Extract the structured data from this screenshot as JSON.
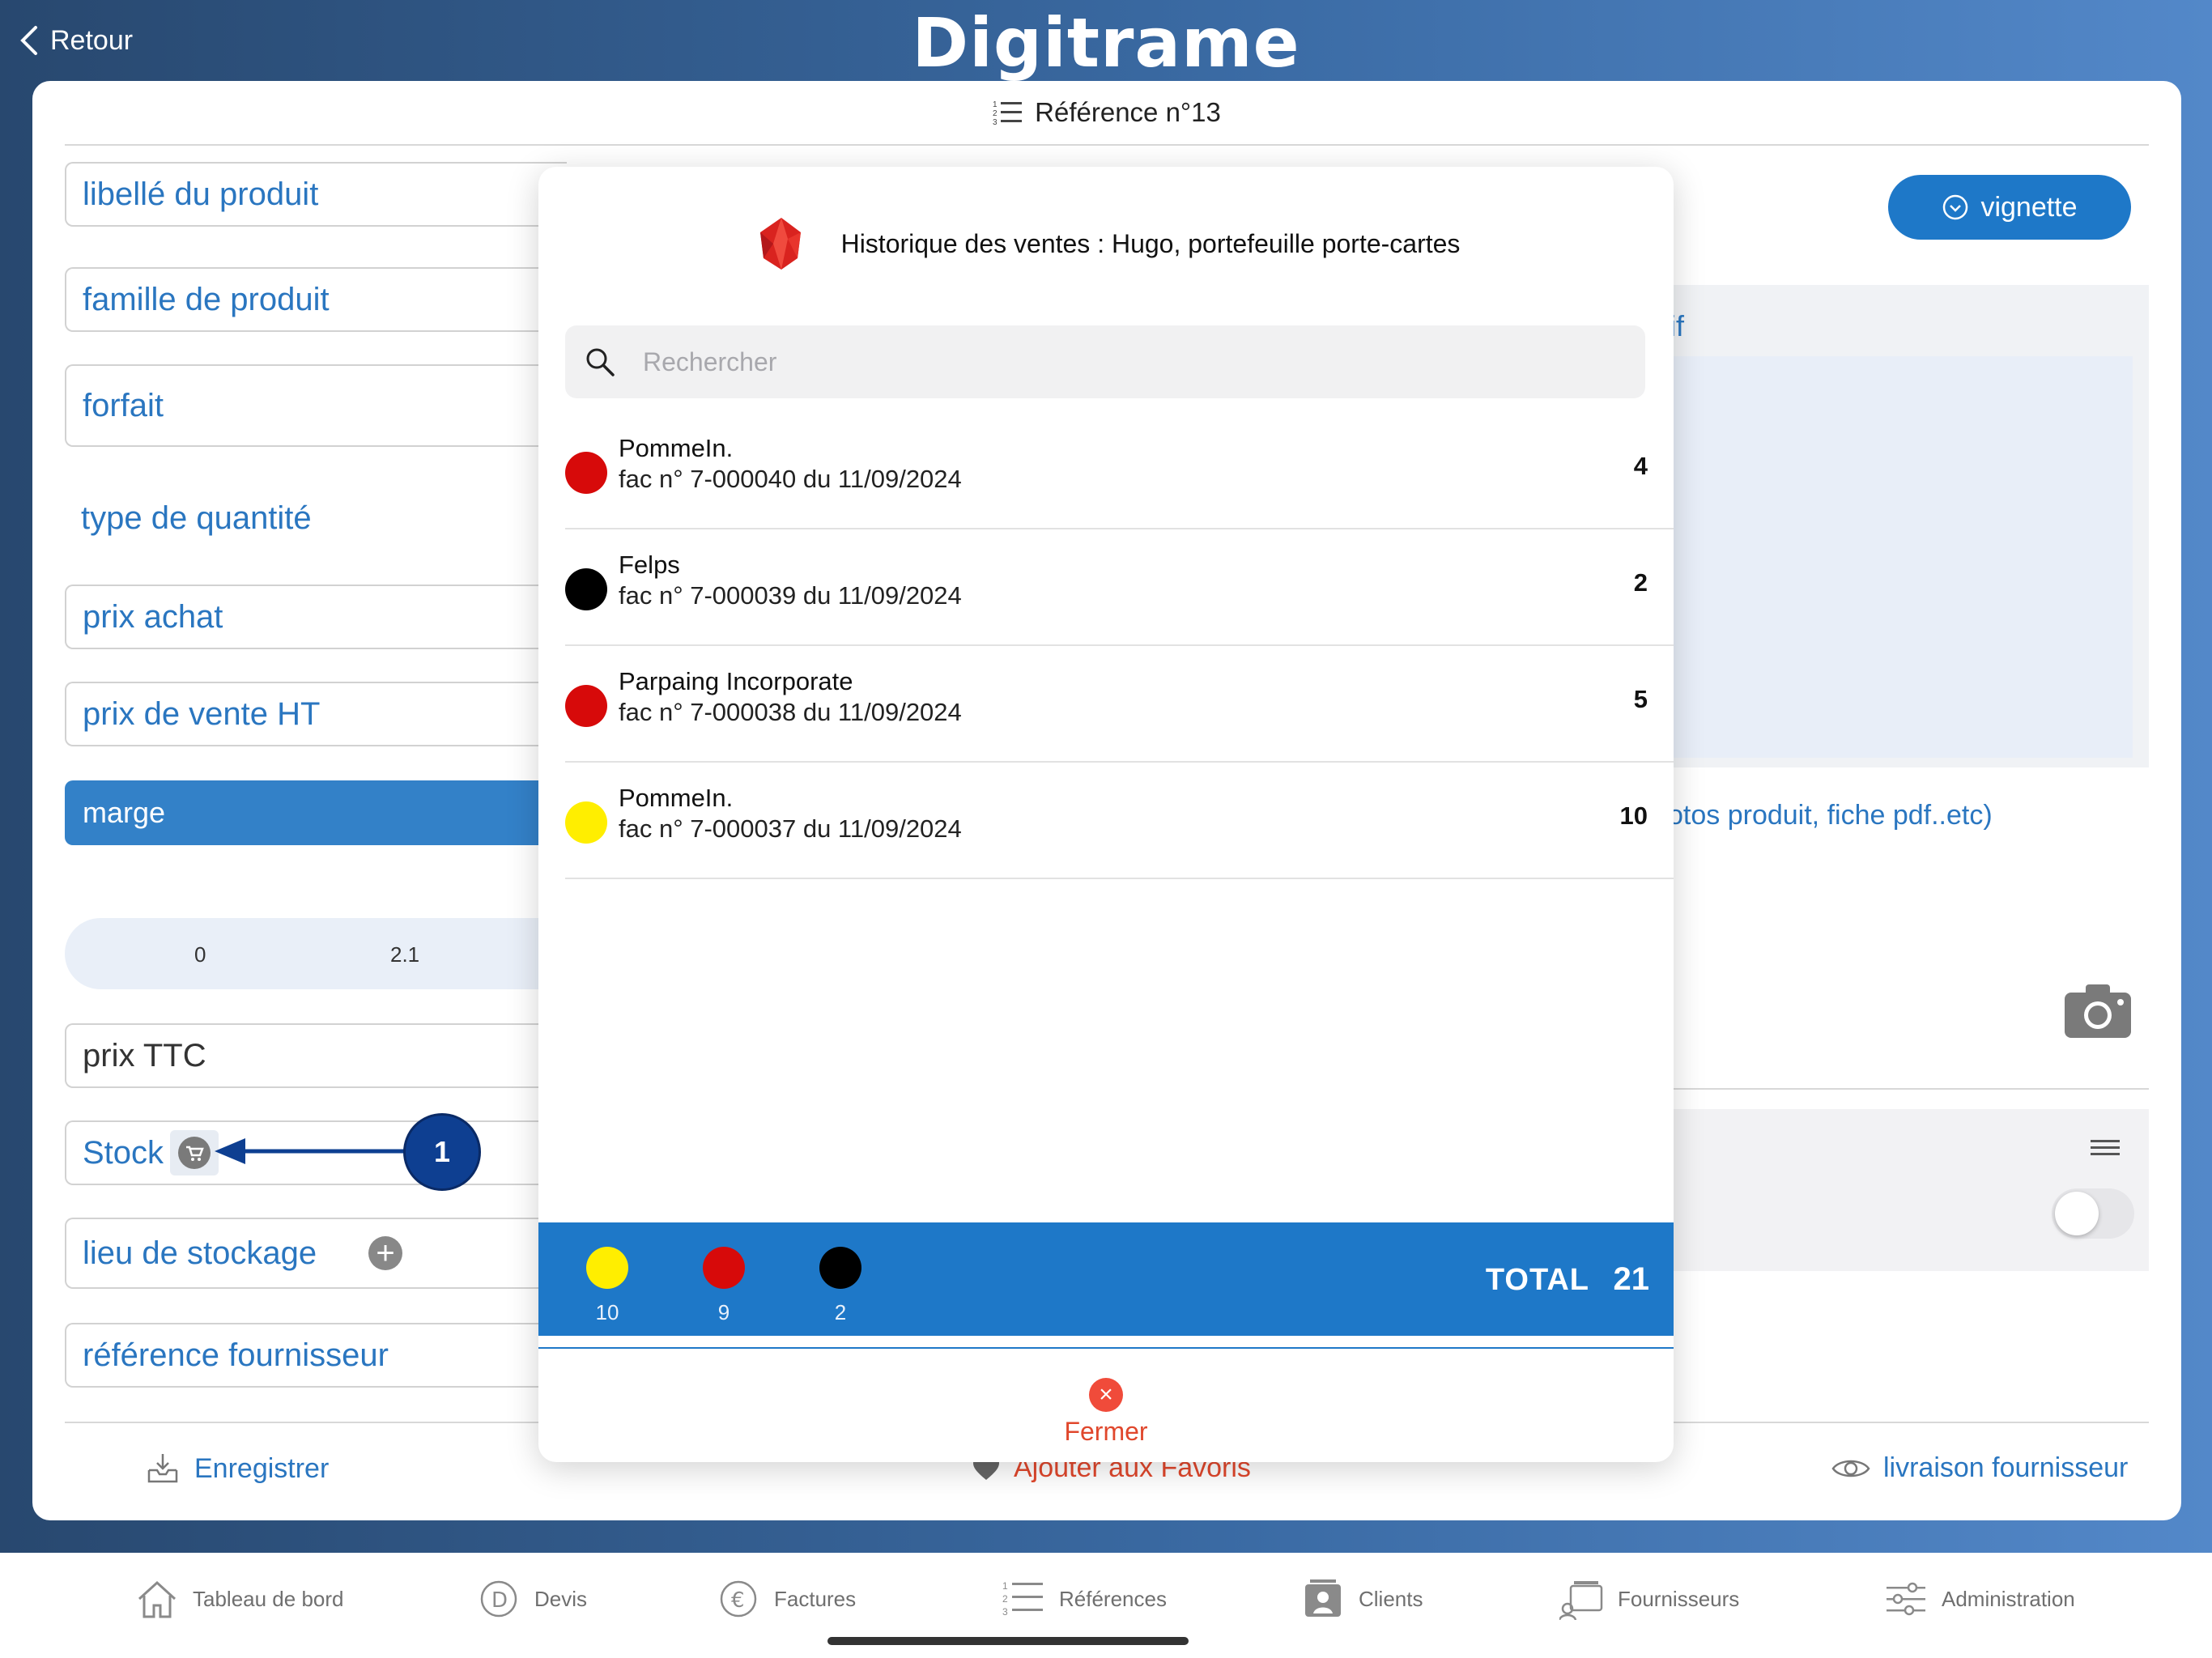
{
  "header": {
    "back_label": "Retour",
    "logo_text": "Digitrame"
  },
  "card": {
    "title": "Référence n°13"
  },
  "form": {
    "libelle": "libellé du produit",
    "famille": "famille de produit",
    "forfait": "forfait",
    "type_quantite": "type de quantité",
    "prix_achat": "prix achat",
    "prix_vente": "prix de vente HT",
    "marge": "marge",
    "slider_min": "0",
    "slider_val": "2.1",
    "prix_ttc": "prix TTC",
    "stock": "Stock",
    "lieu_stockage": "lieu de stockage",
    "ref_fournisseur": "référence fournisseur"
  },
  "right": {
    "vignette_label": "vignette",
    "link_if": "if",
    "link_photos": "otos produit, fiche pdf..etc)"
  },
  "actions": {
    "enregistrer": "Enregistrer",
    "favoris": "Ajouter aux Favoris",
    "livraison": "livraison fournisseur"
  },
  "annotation": {
    "number": "1"
  },
  "modal": {
    "title": "Historique des ventes : Hugo, portefeuille porte-cartes",
    "search_placeholder": "Rechercher",
    "rows": [
      {
        "name": "PommeIn.",
        "ref": "fac n° 7-000040 du 11/09/2024",
        "qty": "4",
        "color": "#d70a0a"
      },
      {
        "name": "Felps",
        "ref": "fac n° 7-000039 du 11/09/2024",
        "qty": "2",
        "color": "#000000"
      },
      {
        "name": "Parpaing Incorporate",
        "ref": "fac n° 7-000038 du 11/09/2024",
        "qty": "5",
        "color": "#d70a0a"
      },
      {
        "name": "PommeIn.",
        "ref": "fac n° 7-000037 du 11/09/2024",
        "qty": "10",
        "color": "#ffee00"
      }
    ],
    "totals": [
      {
        "value": "10",
        "color": "#ffee00"
      },
      {
        "value": "9",
        "color": "#d70a0a"
      },
      {
        "value": "2",
        "color": "#000000"
      }
    ],
    "total_label": "TOTAL",
    "total_value": "21",
    "close_label": "Fermer"
  },
  "tabbar": {
    "items": [
      {
        "label": "Tableau de bord",
        "icon": "home-icon"
      },
      {
        "label": "Devis",
        "icon": "devis-icon"
      },
      {
        "label": "Factures",
        "icon": "euro-icon"
      },
      {
        "label": "Références",
        "icon": "list-icon"
      },
      {
        "label": "Clients",
        "icon": "contact-icon"
      },
      {
        "label": "Fournisseurs",
        "icon": "suppliers-icon"
      },
      {
        "label": "Administration",
        "icon": "sliders-icon"
      }
    ]
  },
  "colors": {
    "accent": "#1e78c8",
    "danger": "#e0472c",
    "annotation": "#0e3f91"
  }
}
